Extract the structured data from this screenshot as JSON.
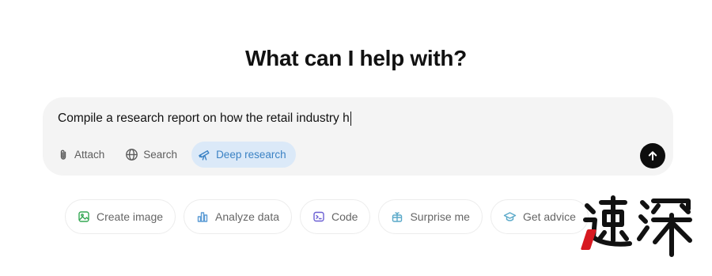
{
  "heading": "What can I help with?",
  "composer": {
    "prompt_text": "Compile a research report on how the retail industry h",
    "tools": [
      {
        "label": "Attach",
        "icon": "paperclip-icon",
        "active": false
      },
      {
        "label": "Search",
        "icon": "globe-icon",
        "active": false
      },
      {
        "label": "Deep research",
        "icon": "telescope-icon",
        "active": true
      }
    ],
    "send_icon": "arrow-up-icon"
  },
  "suggestions": [
    {
      "label": "Create image",
      "icon": "image-icon",
      "color": "#35a854"
    },
    {
      "label": "Analyze data",
      "icon": "bar-chart-icon",
      "color": "#5b9bd5"
    },
    {
      "label": "Code",
      "icon": "terminal-icon",
      "color": "#6b5fd3"
    },
    {
      "label": "Surprise me",
      "icon": "gift-icon",
      "color": "#5aa9c9"
    },
    {
      "label": "Get advice",
      "icon": "graduation-cap-icon",
      "color": "#5aa9c9"
    }
  ],
  "watermark": {
    "text": "速深",
    "accent_color": "#d71920"
  },
  "colors": {
    "composer_bg": "#f4f4f4",
    "active_tool_bg": "#dbe9f8",
    "active_tool_text": "#3b82c4",
    "send_bg": "#0d0d0d"
  }
}
